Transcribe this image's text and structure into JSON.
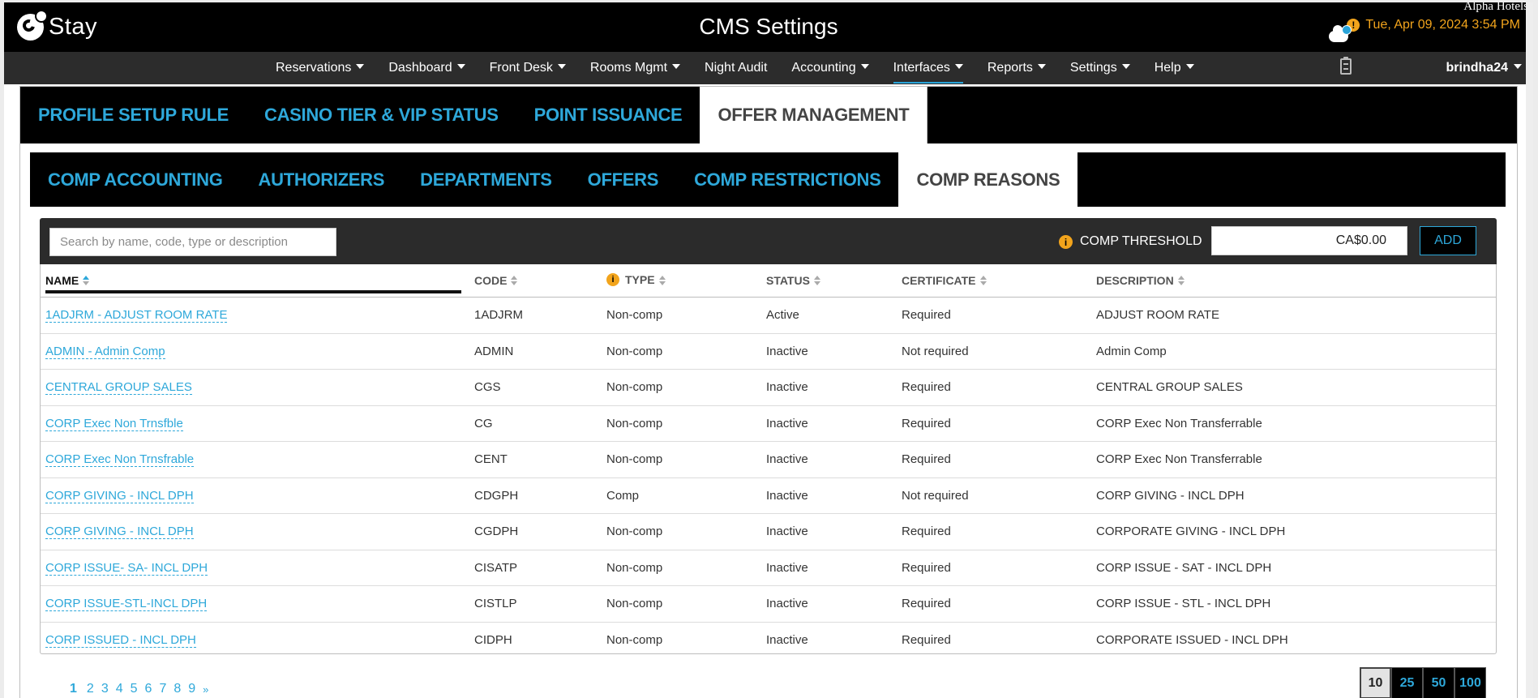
{
  "header": {
    "logo_text": "Stay",
    "title": "CMS Settings",
    "hotel": "Alpha Hotels",
    "datetime": "Tue, Apr 09, 2024 3:54 PM",
    "user": "brindha24"
  },
  "nav": [
    {
      "label": "Reservations",
      "dropdown": true
    },
    {
      "label": "Dashboard",
      "dropdown": true
    },
    {
      "label": "Front Desk",
      "dropdown": true
    },
    {
      "label": "Rooms Mgmt",
      "dropdown": true
    },
    {
      "label": "Night Audit",
      "dropdown": false
    },
    {
      "label": "Accounting",
      "dropdown": true
    },
    {
      "label": "Interfaces",
      "dropdown": true,
      "active": true
    },
    {
      "label": "Reports",
      "dropdown": true
    },
    {
      "label": "Settings",
      "dropdown": true
    },
    {
      "label": "Help",
      "dropdown": true
    }
  ],
  "primary_tabs": [
    {
      "label": "PROFILE SETUP RULE"
    },
    {
      "label": "CASINO TIER & VIP STATUS"
    },
    {
      "label": "POINT ISSUANCE"
    },
    {
      "label": "OFFER MANAGEMENT",
      "active": true
    }
  ],
  "secondary_tabs": [
    {
      "label": "COMP ACCOUNTING"
    },
    {
      "label": "AUTHORIZERS"
    },
    {
      "label": "DEPARTMENTS"
    },
    {
      "label": "OFFERS"
    },
    {
      "label": "COMP RESTRICTIONS"
    },
    {
      "label": "COMP REASONS",
      "active": true
    }
  ],
  "toolbar": {
    "search_placeholder": "Search by name, code, type or description",
    "search_value": "",
    "threshold_label": "COMP THRESHOLD",
    "threshold_value": "CA$0.00",
    "add_label": "ADD"
  },
  "table": {
    "columns": [
      {
        "key": "name",
        "label": "NAME",
        "sort": "asc"
      },
      {
        "key": "code",
        "label": "CODE",
        "sort": "none"
      },
      {
        "key": "type",
        "label": "TYPE",
        "sort": "none",
        "info": true
      },
      {
        "key": "status",
        "label": "STATUS",
        "sort": "none"
      },
      {
        "key": "certificate",
        "label": "CERTIFICATE",
        "sort": "none"
      },
      {
        "key": "description",
        "label": "DESCRIPTION",
        "sort": "none"
      }
    ],
    "rows": [
      {
        "name": "1ADJRM - ADJUST ROOM RATE",
        "code": "1ADJRM",
        "type": "Non-comp",
        "status": "Active",
        "certificate": "Required",
        "description": "ADJUST ROOM RATE"
      },
      {
        "name": "ADMIN - Admin Comp",
        "code": "ADMIN",
        "type": "Non-comp",
        "status": "Inactive",
        "certificate": "Not required",
        "description": "Admin Comp"
      },
      {
        "name": "CENTRAL GROUP SALES",
        "code": "CGS",
        "type": "Non-comp",
        "status": "Inactive",
        "certificate": "Required",
        "description": "CENTRAL GROUP SALES"
      },
      {
        "name": "CORP Exec Non Trnsfble",
        "code": "CG",
        "type": "Non-comp",
        "status": "Inactive",
        "certificate": "Required",
        "description": "CORP Exec Non Transferrable"
      },
      {
        "name": "CORP Exec Non Trnsfrable",
        "code": "CENT",
        "type": "Non-comp",
        "status": "Inactive",
        "certificate": "Required",
        "description": "CORP Exec Non Transferrable"
      },
      {
        "name": "CORP GIVING - INCL DPH",
        "code": "CDGPH",
        "type": "Comp",
        "status": "Inactive",
        "certificate": "Not required",
        "description": "CORP GIVING - INCL DPH"
      },
      {
        "name": "CORP GIVING - INCL DPH",
        "code": "CGDPH",
        "type": "Non-comp",
        "status": "Inactive",
        "certificate": "Required",
        "description": "CORPORATE GIVING - INCL DPH"
      },
      {
        "name": "CORP ISSUE- SA- INCL DPH",
        "code": "CISATP",
        "type": "Non-comp",
        "status": "Inactive",
        "certificate": "Required",
        "description": "CORP ISSUE - SAT - INCL DPH"
      },
      {
        "name": "CORP ISSUE-STL-INCL DPH",
        "code": "CISTLP",
        "type": "Non-comp",
        "status": "Inactive",
        "certificate": "Required",
        "description": "CORP ISSUE - STL - INCL DPH"
      },
      {
        "name": "CORP ISSUED - INCL DPH",
        "code": "CIDPH",
        "type": "Non-comp",
        "status": "Inactive",
        "certificate": "Required",
        "description": "CORPORATE ISSUED - INCL DPH"
      }
    ]
  },
  "pagination": {
    "pages": [
      "1",
      "2",
      "3",
      "4",
      "5",
      "6",
      "7",
      "8",
      "9"
    ],
    "current": "1",
    "next": "»",
    "page_sizes": [
      "10",
      "25",
      "50",
      "100"
    ],
    "page_size": "10"
  },
  "colors": {
    "accent": "#2ea8da",
    "warning": "#f2a41c",
    "header_bg": "#000000",
    "nav_bg": "#2c2c2c"
  },
  "icons": {
    "warning": "warning-icon",
    "notification": "cloud-notification-icon",
    "clipboard": "clipboard-icon",
    "info": "info-icon",
    "sort": "sort-icon"
  }
}
